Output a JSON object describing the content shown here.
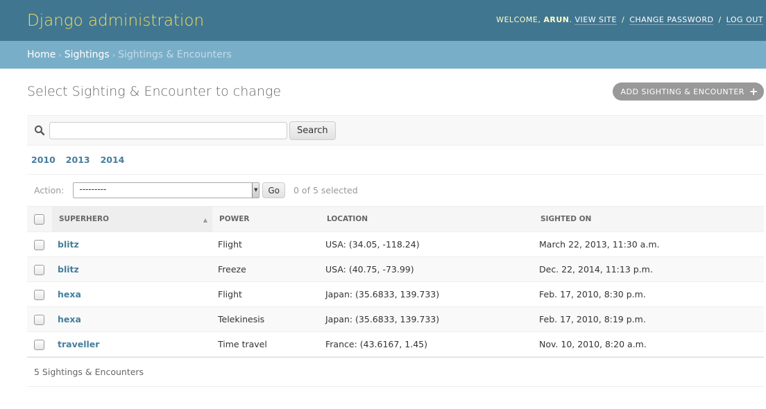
{
  "header": {
    "branding": "Django administration",
    "welcome": "Welcome,",
    "username": "Arun",
    "view_site": "View site",
    "change_password": "Change password",
    "log_out": "Log out",
    "separator": "/"
  },
  "breadcrumbs": {
    "home": "Home",
    "app": "Sightings",
    "current": "Sightings & Encounters",
    "arrow": "›"
  },
  "page": {
    "title": "Select Sighting & Encounter to change",
    "add_button": "Add Sighting & Encounter",
    "add_icon": "+"
  },
  "search": {
    "value": "",
    "placeholder": "",
    "button": "Search"
  },
  "date_hierarchy": [
    "2010",
    "2013",
    "2014"
  ],
  "actions": {
    "label": "Action:",
    "selected_option": "---------",
    "go": "Go",
    "counter": "0 of 5 selected"
  },
  "table": {
    "columns": [
      "Superhero",
      "Power",
      "Location",
      "Sighted on"
    ],
    "sorted_column": "Superhero",
    "rows": [
      {
        "superhero": "blitz",
        "power": "Flight",
        "location": "USA: (34.05, -118.24)",
        "sighted_on": "March 22, 2013, 11:30 a.m."
      },
      {
        "superhero": "blitz",
        "power": "Freeze",
        "location": "USA: (40.75, -73.99)",
        "sighted_on": "Dec. 22, 2014, 11:13 p.m."
      },
      {
        "superhero": "hexa",
        "power": "Flight",
        "location": "Japan: (35.6833, 139.733)",
        "sighted_on": "Feb. 17, 2010, 8:30 p.m."
      },
      {
        "superhero": "hexa",
        "power": "Telekinesis",
        "location": "Japan: (35.6833, 139.733)",
        "sighted_on": "Feb. 17, 2010, 8:19 p.m."
      },
      {
        "superhero": "traveller",
        "power": "Time travel",
        "location": "France: (43.6167, 1.45)",
        "sighted_on": "Nov. 10, 2010, 8:20 a.m."
      }
    ]
  },
  "paginator": "5 Sightings & Encounters",
  "colors": {
    "header_bg": "#417690",
    "branding": "#f5dd5d",
    "breadcrumbs_bg": "#79aec8",
    "link": "#447e9b"
  }
}
